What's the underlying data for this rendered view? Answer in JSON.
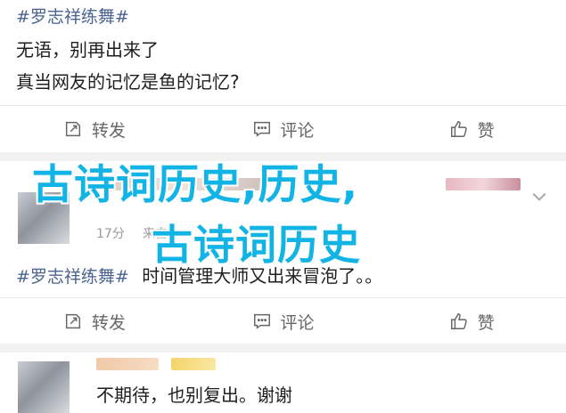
{
  "post1": {
    "hashtag": "#罗志祥练舞#",
    "line1": "无语，别再出来了",
    "line2": "真当网友的记忆是鱼的记忆?"
  },
  "actions1": {
    "repost": "转发",
    "comment": "评论",
    "like": "赞"
  },
  "post2": {
    "time": "17分",
    "source_partial": "来自",
    "hashtag": "#罗志祥练舞#",
    "text": "时间管理大师又出来冒泡了。。"
  },
  "actions2": {
    "repost": "转发",
    "comment": "评论",
    "like": "赞"
  },
  "post3": {
    "text": "不期待，也别复出。谢谢"
  },
  "overlay": {
    "line1": "古诗词历史,历史,",
    "line2": "古诗词历史"
  },
  "colors": {
    "hashtag": "#4a6390",
    "overlay": "#12b4e6",
    "action_text": "#666666"
  },
  "icons": [
    "repost-icon",
    "comment-icon",
    "like-icon",
    "chevron-down-icon"
  ]
}
